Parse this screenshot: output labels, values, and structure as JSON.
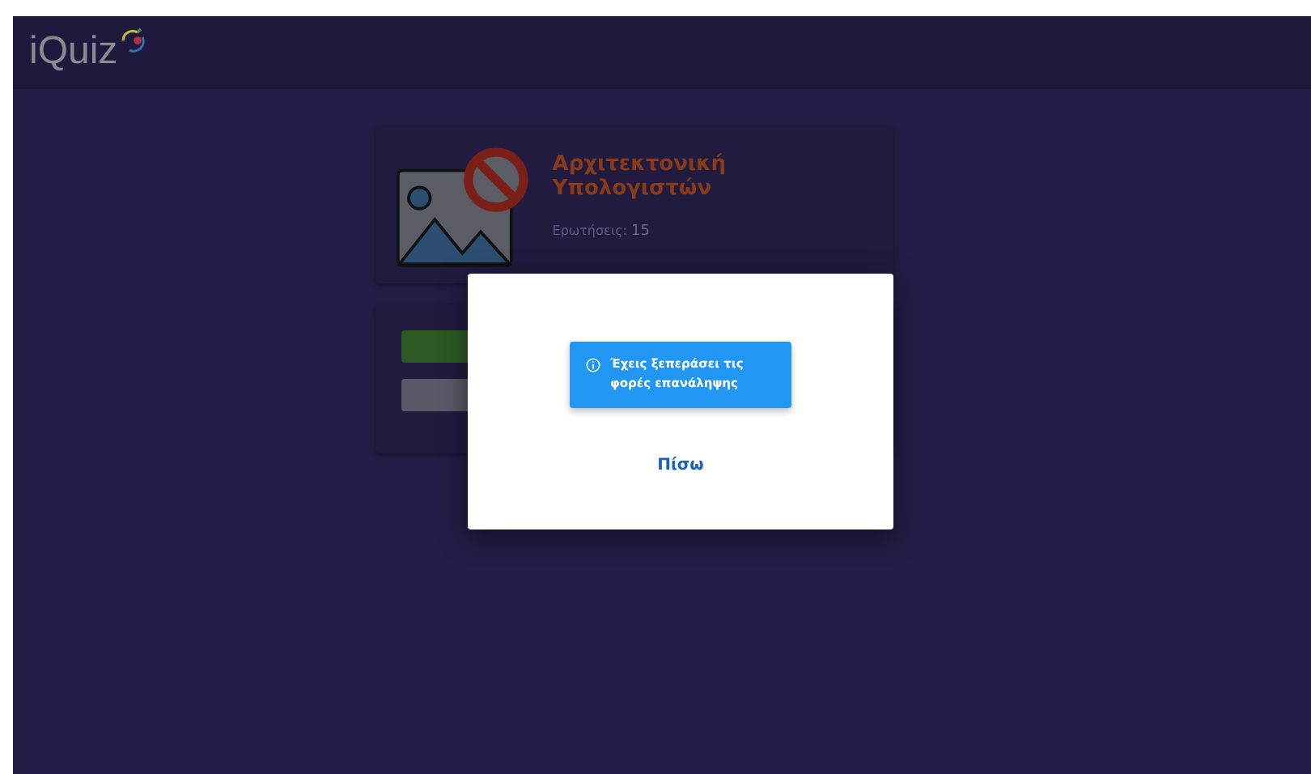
{
  "header": {
    "logo_text": "iQuiz"
  },
  "quiz_card": {
    "title": "Αρχιτεκτονική Υπολογιστών",
    "questions_label": "Ερωτήσεις:",
    "questions_count": "15"
  },
  "actions": [
    {
      "kind": "primary"
    },
    {
      "kind": "secondary"
    }
  ],
  "dialog": {
    "alert": {
      "kind": "info",
      "message": "Έχεις ξεπεράσει τις φορές επανάληψης"
    },
    "back_button": "Πίσω"
  }
}
